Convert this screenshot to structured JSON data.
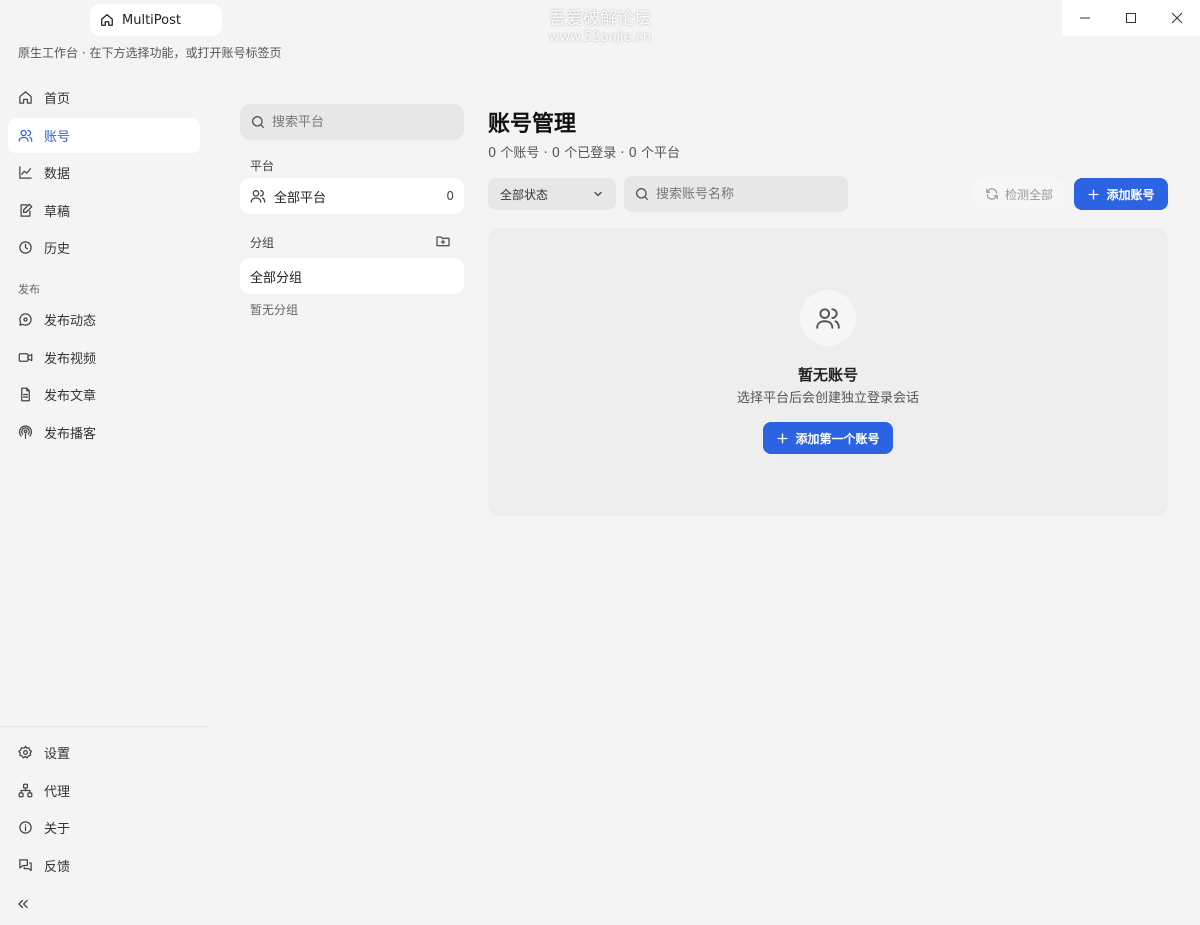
{
  "titlebar": {
    "app_tab_label": "MultiPost",
    "watermark_line1": "吾爱破解论坛",
    "watermark_line2": "www.52pojie.cn"
  },
  "subtitle": "原生工作台 · 在下方选择功能，或打开账号标签页",
  "sidebar": {
    "items": [
      {
        "label": "首页",
        "icon": "home-icon"
      },
      {
        "label": "账号",
        "icon": "users-icon",
        "active": true
      },
      {
        "label": "数据",
        "icon": "chart-line-icon"
      },
      {
        "label": "草稿",
        "icon": "draft-edit-icon"
      },
      {
        "label": "历史",
        "icon": "clock-icon"
      }
    ],
    "section_publish": "发布",
    "publish_items": [
      {
        "label": "发布动态",
        "icon": "message-circle-icon"
      },
      {
        "label": "发布视频",
        "icon": "video-icon"
      },
      {
        "label": "发布文章",
        "icon": "file-text-icon"
      },
      {
        "label": "发布播客",
        "icon": "podcast-icon"
      }
    ],
    "bottom_items": [
      {
        "label": "设置",
        "icon": "gear-icon"
      },
      {
        "label": "代理",
        "icon": "network-icon"
      },
      {
        "label": "关于",
        "icon": "info-icon"
      },
      {
        "label": "反馈",
        "icon": "chat-bubbles-icon"
      }
    ]
  },
  "platforms": {
    "search_placeholder": "搜索平台",
    "section_label": "平台",
    "all_platforms_label": "全部平台",
    "all_platforms_count": "0",
    "groups_label": "分组",
    "all_groups_label": "全部分组",
    "no_groups_label": "暂无分组"
  },
  "main": {
    "title": "账号管理",
    "summary": "0 个账号 · 0 个已登录 · 0 个平台",
    "status_filter": "全部状态",
    "account_search_placeholder": "搜索账号名称",
    "check_all_label": "检测全部",
    "add_account_label": "添加账号",
    "empty_title": "暂无账号",
    "empty_desc": "选择平台后会创建独立登录会话",
    "add_first_label": "添加第一个账号"
  },
  "colors": {
    "accent": "#2b63e3",
    "background": "#f4f4f4"
  }
}
